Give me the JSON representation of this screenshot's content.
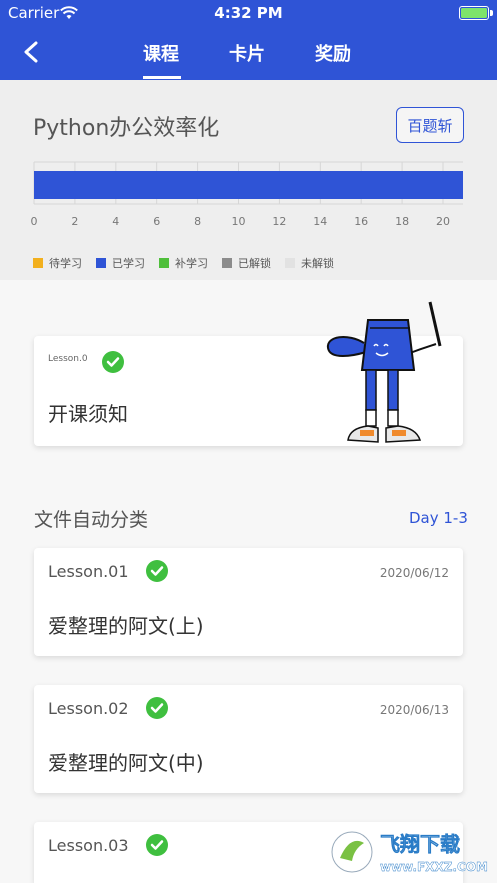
{
  "status": {
    "carrier": "Carrier",
    "time": "4:32 PM"
  },
  "nav": {
    "tabs": [
      "课程",
      "卡片",
      "奖励"
    ],
    "active_tab": "课程"
  },
  "header": {
    "title": "Python办公效率化",
    "button_label": "百题斩"
  },
  "legend": [
    {
      "label": "待学习",
      "color": "#f2b01e"
    },
    {
      "label": "已学习",
      "color": "#2f54d6"
    },
    {
      "label": "补学习",
      "color": "#4fbf3b"
    },
    {
      "label": "已解锁",
      "color": "#8c8c8c"
    },
    {
      "label": "未解锁",
      "color": "#e2e2e2"
    }
  ],
  "progress": {
    "learned": 21,
    "max": 21,
    "ticks": [
      "0",
      "2",
      "4",
      "6",
      "8",
      "10",
      "12",
      "14",
      "16",
      "18",
      "20"
    ]
  },
  "intro_card": {
    "lesson": "Lesson.0",
    "title": "开课须知"
  },
  "section": {
    "title": "文件自动分类",
    "day": "Day 1-3"
  },
  "lessons": [
    {
      "label": "Lesson.01",
      "date": "2020/06/12",
      "title": "爱整理的阿文(上)"
    },
    {
      "label": "Lesson.02",
      "date": "2020/06/13",
      "title": "爱整理的阿文(中)"
    },
    {
      "label": "Lesson.03",
      "date": "",
      "title": ""
    }
  ],
  "watermark": {
    "text": "飞翔下载",
    "url": "www.FXXZ.COM"
  }
}
